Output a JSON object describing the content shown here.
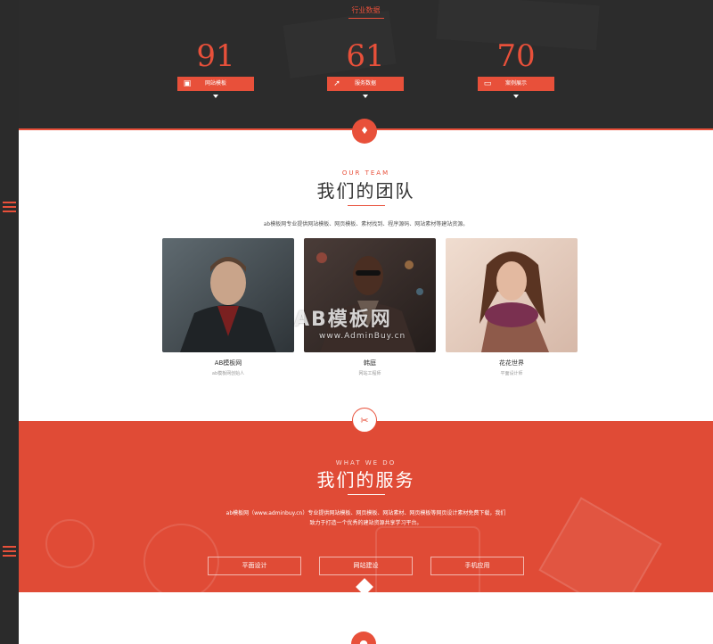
{
  "colors": {
    "accent": "#e8503a",
    "dark": "#2c2c2c",
    "services_bg": "#e04b36"
  },
  "stats": {
    "title": "行业数据",
    "items": [
      {
        "number": "91",
        "label": "网站模板",
        "icon": "gift-icon"
      },
      {
        "number": "61",
        "label": "服务数据",
        "icon": "rocket-icon"
      },
      {
        "number": "70",
        "label": "案例展示",
        "icon": "laptop-icon"
      }
    ]
  },
  "team": {
    "subtitle": "OUR TEAM",
    "title": "我们的团队",
    "description": "ab模板网专业提供网站模板、网页模板、素材找到、程序源码、网站素材等建站资源。",
    "members": [
      {
        "name": "AB模板网",
        "role": "ab模板网创始人"
      },
      {
        "name": "韩庭",
        "role": "网站工程师"
      },
      {
        "name": "花花世界",
        "role": "平面设计师"
      }
    ]
  },
  "watermark": {
    "main": "AB模板网",
    "sub": "www.AdminBuy.cn"
  },
  "services": {
    "subtitle": "WHAT WE DO",
    "title": "我们的服务",
    "description_line1": "ab模板网（www.adminbuy.cn）专业提供网站模板、网页模板、网站素材、网页模板等网页设计素材免费下载，我们",
    "description_line2": "致力于打造一个优秀的建站资源共享学习平台。",
    "buttons": [
      "平面设计",
      "网站建设",
      "手机应用"
    ]
  }
}
